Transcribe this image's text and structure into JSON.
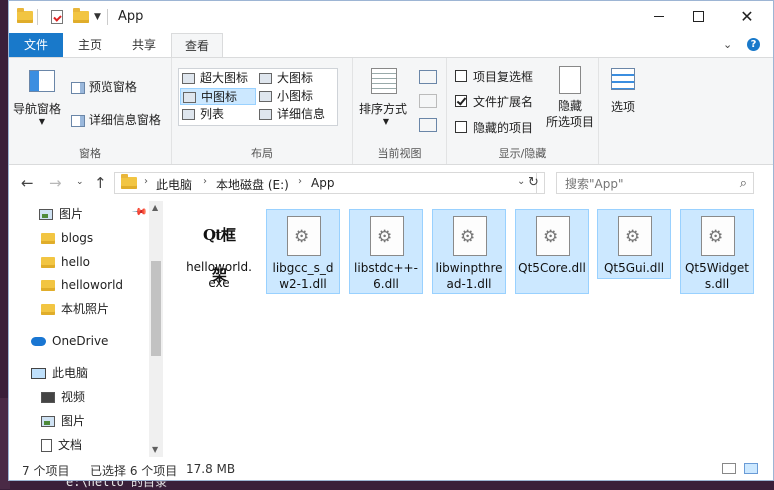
{
  "window": {
    "title": "App"
  },
  "tabs": {
    "file": "文件",
    "home": "主页",
    "share": "共享",
    "view": "查看"
  },
  "ribbon": {
    "panes": {
      "nav_pane": "导航窗格",
      "preview_pane": "预览窗格",
      "details_pane": "详细信息窗格",
      "group_label": "窗格"
    },
    "layout": {
      "items": [
        "超大图标",
        "大图标",
        "中图标",
        "小图标",
        "列表",
        "详细信息"
      ],
      "selected": "中图标",
      "group_label": "布局"
    },
    "current_view": {
      "sort_by": "排序方式",
      "group_label": "当前视图"
    },
    "show_hide": {
      "item_checkboxes": "项目复选框",
      "file_extensions": "文件扩展名",
      "hidden_items": "隐藏的项目",
      "hide_selected": "隐藏\n所选项目",
      "group_label": "显示/隐藏",
      "checked": {
        "item_checkboxes": false,
        "file_extensions": true,
        "hidden_items": false
      }
    },
    "options": "选项"
  },
  "address": {
    "segments": [
      "此电脑",
      "本地磁盘 (E:)",
      "App"
    ]
  },
  "search": {
    "placeholder": "搜索\"App\""
  },
  "navpane": {
    "items": [
      {
        "label": "图片",
        "type": "pictures"
      },
      {
        "label": "blogs",
        "type": "folder"
      },
      {
        "label": "hello",
        "type": "folder"
      },
      {
        "label": "helloworld",
        "type": "folder"
      },
      {
        "label": "本机照片",
        "type": "folder"
      },
      {
        "label": "OneDrive",
        "type": "cloud"
      },
      {
        "label": "此电脑",
        "type": "pc"
      },
      {
        "label": "视频",
        "type": "videos"
      },
      {
        "label": "图片",
        "type": "pictures"
      },
      {
        "label": "文档",
        "type": "documents"
      }
    ]
  },
  "files": [
    {
      "name": "helloworld.exe",
      "icon_text": "Qt框架",
      "selected": false
    },
    {
      "name": "libgcc_s_dw2-1.dll",
      "selected": true
    },
    {
      "name": "libstdc++-6.dll",
      "selected": true
    },
    {
      "name": "libwinpthread-1.dll",
      "selected": true
    },
    {
      "name": "Qt5Core.dll",
      "selected": true
    },
    {
      "name": "Qt5Gui.dll",
      "selected": true
    },
    {
      "name": "Qt5Widgets.dll",
      "selected": true
    }
  ],
  "status": {
    "count": "7 个项目",
    "selection": "已选择 6 个项目",
    "size": "17.8 MB"
  },
  "background": {
    "caption": "e:\\hello 的目录"
  },
  "colors": {
    "accent": "#1979ca",
    "selection_bg": "#cce8ff",
    "selection_border": "#99d1ff"
  }
}
